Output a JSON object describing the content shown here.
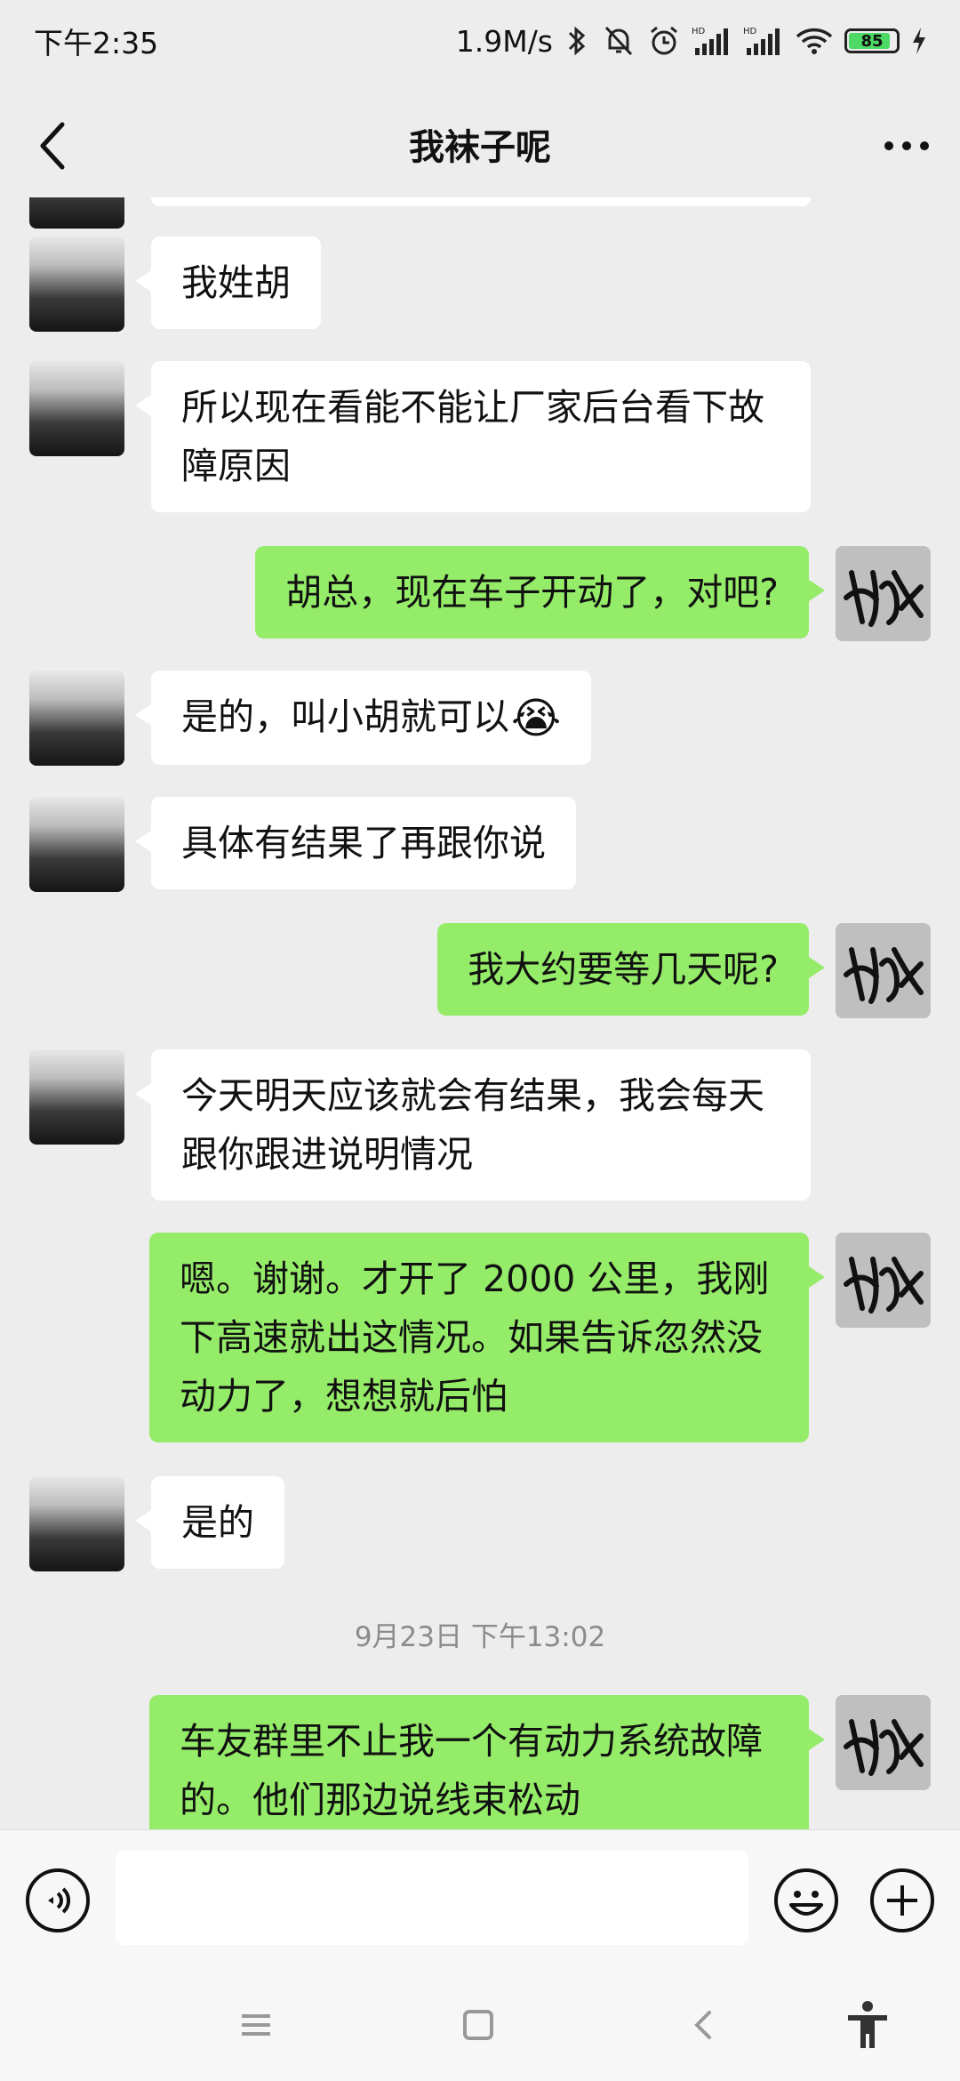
{
  "status_bar": {
    "time": "下午2:35",
    "network_speed": "1.9M/s",
    "battery_level": "85"
  },
  "header": {
    "title": "我袜子呢"
  },
  "messages": [
    {
      "side": "in",
      "text": "我姓胡"
    },
    {
      "side": "in",
      "text": "所以现在看能不能让厂家后台看下故障原因"
    },
    {
      "side": "out",
      "text": "胡总，现在车子开动了，对吧?"
    },
    {
      "side": "in",
      "text": "是的，叫小胡就可以",
      "emoji": "😭"
    },
    {
      "side": "in",
      "text": "具体有结果了再跟你说"
    },
    {
      "side": "out",
      "text": "我大约要等几天呢?"
    },
    {
      "side": "in",
      "text": "今天明天应该就会有结果，我会每天跟你跟进说明情况"
    },
    {
      "side": "out",
      "text": "嗯。谢谢。才开了 2000 公里，我刚下高速就出这情况。如果告诉忽然没动力了，想想就后怕"
    },
    {
      "side": "in",
      "text": "是的"
    },
    {
      "side": "out",
      "text": "车友群里不止我一个有动力系统故障的。他们那边说线束松动"
    }
  ],
  "timestamp": "9月23日 下午13:02",
  "input": {
    "value": ""
  },
  "icons": {
    "back": "chevron-left-icon",
    "more": "more-dots-icon",
    "voice": "voice-icon",
    "emoji": "emoji-smile-icon",
    "plus": "plus-circle-icon",
    "nav_menu": "menu-icon",
    "nav_home": "home-square-icon",
    "nav_back": "back-chevron-icon",
    "accessibility": "accessibility-icon"
  },
  "colors": {
    "outgoing_bubble": "#95ec69",
    "incoming_bubble": "#ffffff",
    "background": "#ededed"
  }
}
